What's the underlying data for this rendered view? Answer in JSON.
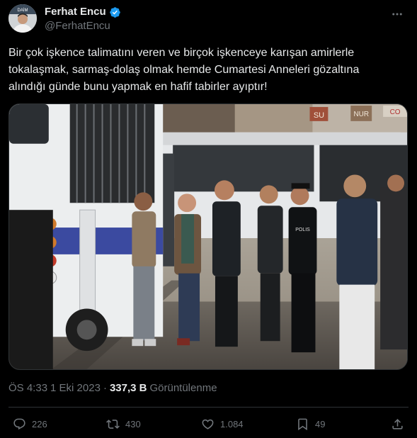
{
  "author": {
    "display_name": "Ferhat Encu",
    "handle": "@FerhatEncu",
    "verified_icon": "verified-badge-icon",
    "avatar_text": "DAİM"
  },
  "tweet": {
    "text": "Bir çok işkence talimatını veren ve birçok işkenceye karışan amirlerle\ntokalaşmak, sarmaş-dolaş olmak hemde Cumartesi Anneleri gözaltına\nalındığı günde bunu yapmak en hafif tabirler ayıptır!",
    "photo_signs": {
      "sign_1": "SU",
      "sign_2": "NUR",
      "sign_3": "CO",
      "police_text": "POLIS"
    }
  },
  "meta": {
    "time": "ÖS 4:33",
    "separator": "·",
    "date": "1 Eki 2023",
    "views_count": "337,3 B",
    "views_label": "Görüntülenme"
  },
  "actions": {
    "reply_count": "226",
    "retweet_count": "430",
    "like_count": "1.084",
    "bookmark_count": "49"
  },
  "colors": {
    "background": "#000000",
    "text_primary": "#e7e9ea",
    "text_secondary": "#71767b",
    "verified_blue": "#1d9bf0",
    "border": "#2f3336"
  }
}
